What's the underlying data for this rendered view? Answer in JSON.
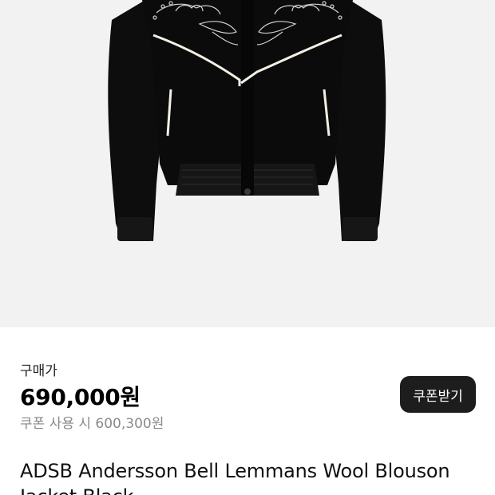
{
  "product": {
    "image_alt": "ADSB Andersson Bell Lemmans Wool Blouson Jacket Black",
    "price_label": "구매가",
    "price": "690,000원",
    "coupon_price_text": "쿠폰 사용 시 600,300원",
    "coupon_button_label": "쿠폰받기",
    "title": "ADSB Andersson Bell Lemmans Wool Blouson Jacket Black"
  },
  "colors": {
    "image_background": "#f2f2f2",
    "jacket": "#0c0c0c",
    "piping": "#f4efe4",
    "button_background": "#1d1d1d"
  }
}
